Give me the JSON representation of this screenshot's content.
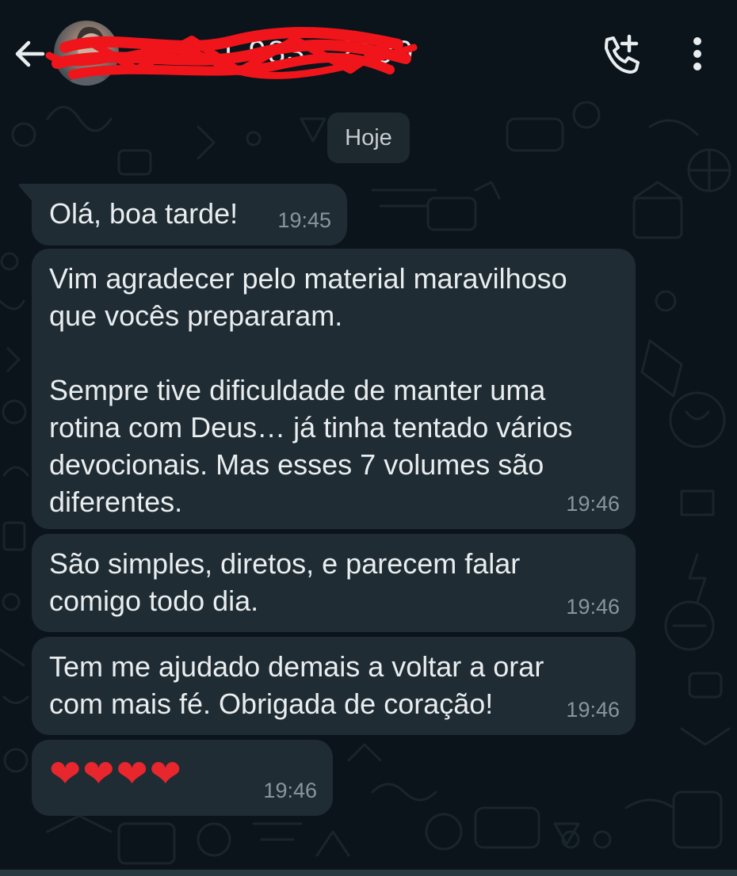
{
  "header": {
    "back_icon": "arrow-left-icon",
    "avatar_icon": "contact-avatar",
    "contact_name": "+55 11 9837-2190",
    "call_icon": "add-call-icon",
    "menu_icon": "more-vertical-icon"
  },
  "chat": {
    "date_chip": "Hoje",
    "messages": [
      {
        "text": "Olá, boa tarde!",
        "time": "19:45"
      },
      {
        "text": "Vim agradecer pelo material maravilhoso\nque vocês prepararam.\n\nSempre tive dificuldade de manter uma\nrotina com Deus… já tinha tentado vários\ndevocionais. Mas esses 7 volumes são\ndiferentes.",
        "time": "19:46"
      },
      {
        "text": "São simples, diretos, e parecem falar\ncomigo todo dia.",
        "time": "19:46"
      },
      {
        "text": "Tem me ajudado demais a voltar a orar\ncom mais fé. Obrigada de coração!",
        "time": "19:46"
      },
      {
        "text": "❤❤❤❤",
        "time": "19:46"
      }
    ]
  },
  "colors": {
    "background": "#0b141a",
    "bubble": "#1f2c33",
    "text": "#e9edef",
    "timestamp": "#8696a0",
    "heart": "#e8262e"
  }
}
